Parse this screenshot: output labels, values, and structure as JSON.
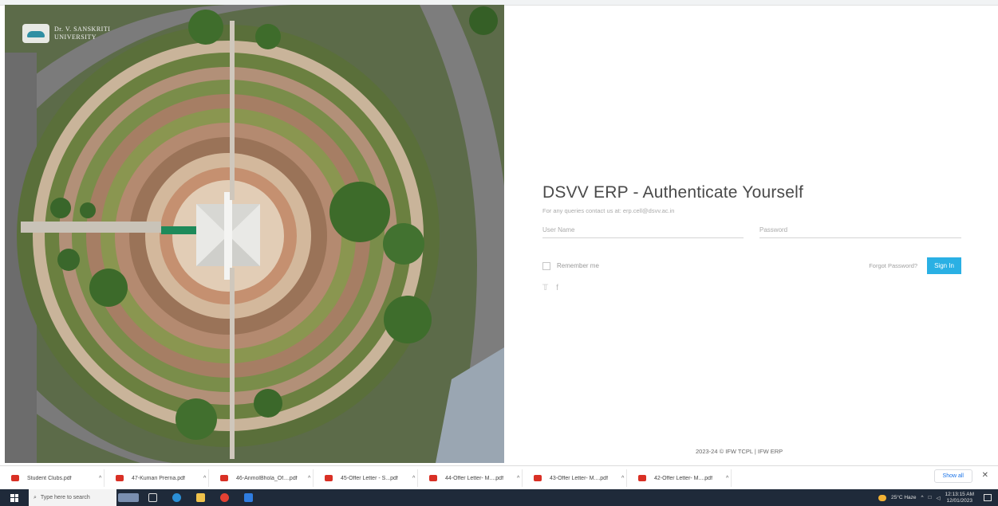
{
  "brand": {
    "logo_text_line1": "Dr. V. SANSKRITI",
    "logo_text_line2": "UNIVERSITY"
  },
  "auth": {
    "title": "DSVV ERP - Authenticate Yourself",
    "subtitle": "For any queries contact us at: erp.cell@dsvv.ac.in",
    "username_placeholder": "User Name",
    "password_placeholder": "Password",
    "remember_label": "Remember me",
    "forgot_label": "Forgot Password?",
    "signin_label": "Sign In",
    "social_icons": [
      "twitter-icon",
      "facebook-icon"
    ]
  },
  "footer": {
    "text": "2023-24 © IFW TCPL | IFW ERP"
  },
  "downloads": {
    "items": [
      {
        "name": "Student Clubs.pdf"
      },
      {
        "name": "47-Kumari Prerna.pdf"
      },
      {
        "name": "46-AnmolBhola_Of....pdf"
      },
      {
        "name": "45-Offer Letter - S...pdf"
      },
      {
        "name": "44-Offer Letter- M....pdf"
      },
      {
        "name": "43-Offer Letter- M....pdf"
      },
      {
        "name": "42-Offer Letter- M....pdf"
      }
    ],
    "show_all_label": "Show all",
    "close_label": "✕"
  },
  "taskbar": {
    "search_placeholder": "Type here to search",
    "weather": "25°C Haze",
    "time": "12:13:15 AM",
    "date": "12/01/2023"
  },
  "colors": {
    "accent": "#2ab0e4",
    "pdf": "#d93025",
    "taskbar": "#1f2a3a"
  }
}
